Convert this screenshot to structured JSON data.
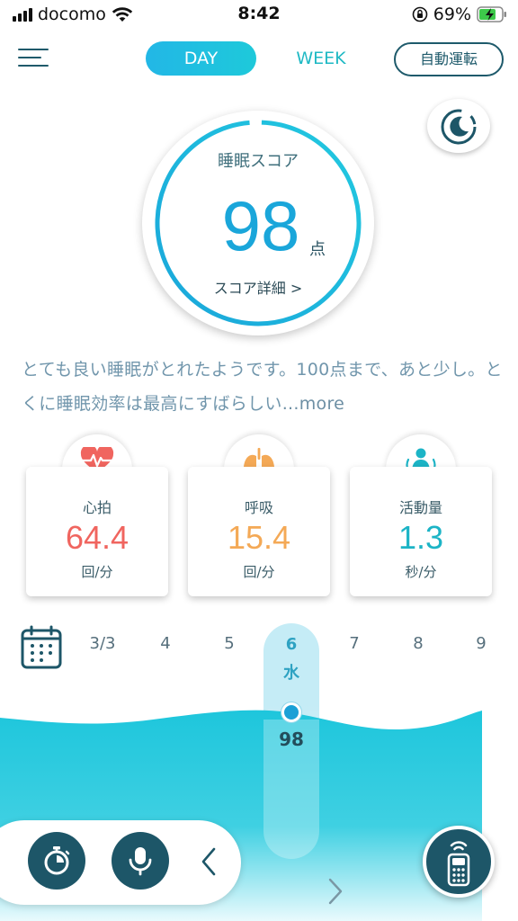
{
  "status_bar": {
    "carrier": "docomo",
    "time": "8:42",
    "battery": "69%"
  },
  "header": {
    "tab_day": "DAY",
    "tab_week": "WEEK",
    "auto_button": "自動運転"
  },
  "score": {
    "label": "睡眠スコア",
    "value": "98",
    "unit": "点",
    "detail_link": "スコア詳細 >"
  },
  "summary": {
    "text": "とても良い睡眠がとれたようです。100点まで、あと少し。とくに睡眠効率は最高にすばらしい",
    "more": "...more"
  },
  "metrics": [
    {
      "label": "心拍",
      "value": "64.4",
      "unit": "回/分",
      "color": "#f0655f",
      "icon": "heart-rate-icon"
    },
    {
      "label": "呼吸",
      "value": "15.4",
      "unit": "回/分",
      "color": "#f4a956",
      "icon": "lungs-icon"
    },
    {
      "label": "活動量",
      "value": "1.3",
      "unit": "秒/分",
      "color": "#1cb4c6",
      "icon": "activity-person-icon"
    }
  ],
  "dates": [
    "3/3",
    "4",
    "5",
    "6",
    "7",
    "8",
    "9"
  ],
  "selected_date": {
    "date": "6",
    "weekday": "水",
    "score": "98"
  },
  "colors": {
    "accent": "#1aa6da",
    "dark": "#1d5668",
    "wave": "#1ec6dc"
  }
}
